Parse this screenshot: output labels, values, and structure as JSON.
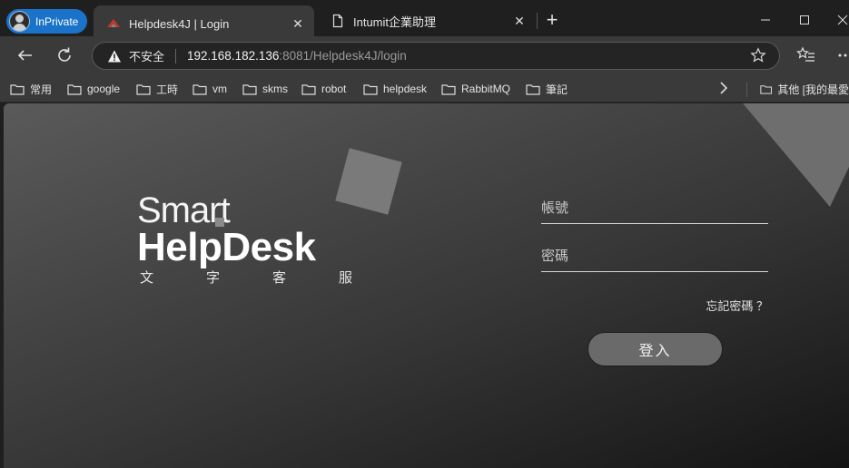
{
  "browser": {
    "inprivate_label": "InPrivate",
    "tabs": [
      {
        "title": "Helpdesk4J | Login",
        "active": true
      },
      {
        "title": "Intumit企業助理",
        "active": false
      }
    ],
    "new_tab_label": "+"
  },
  "addressbar": {
    "security_label": "不安全",
    "url_host": "192.168.182.136",
    "url_rest": ":8081/Helpdesk4J/login"
  },
  "bookmarks": [
    "常用",
    "google",
    "工時",
    "vm",
    "skms",
    "robot",
    "helpdesk",
    "RabbitMQ",
    "筆記"
  ],
  "bookmarks_overflow_label": "其他 [我的最愛",
  "page": {
    "logo_smart": "Smart",
    "logo_helpdesk": "HelpDesk",
    "logo_subtitle": [
      "文",
      "字",
      "客",
      "服"
    ],
    "account_placeholder": "帳號",
    "password_placeholder": "密碼",
    "forgot_password": "忘記密碼 ？",
    "login_button": "登入"
  },
  "colors": {
    "inprivate": "#1a73c8",
    "chrome_bg": "#1f1f1f",
    "toolbar_bg": "#3a3a3a",
    "login_button_bg": "#6a6a6a"
  }
}
